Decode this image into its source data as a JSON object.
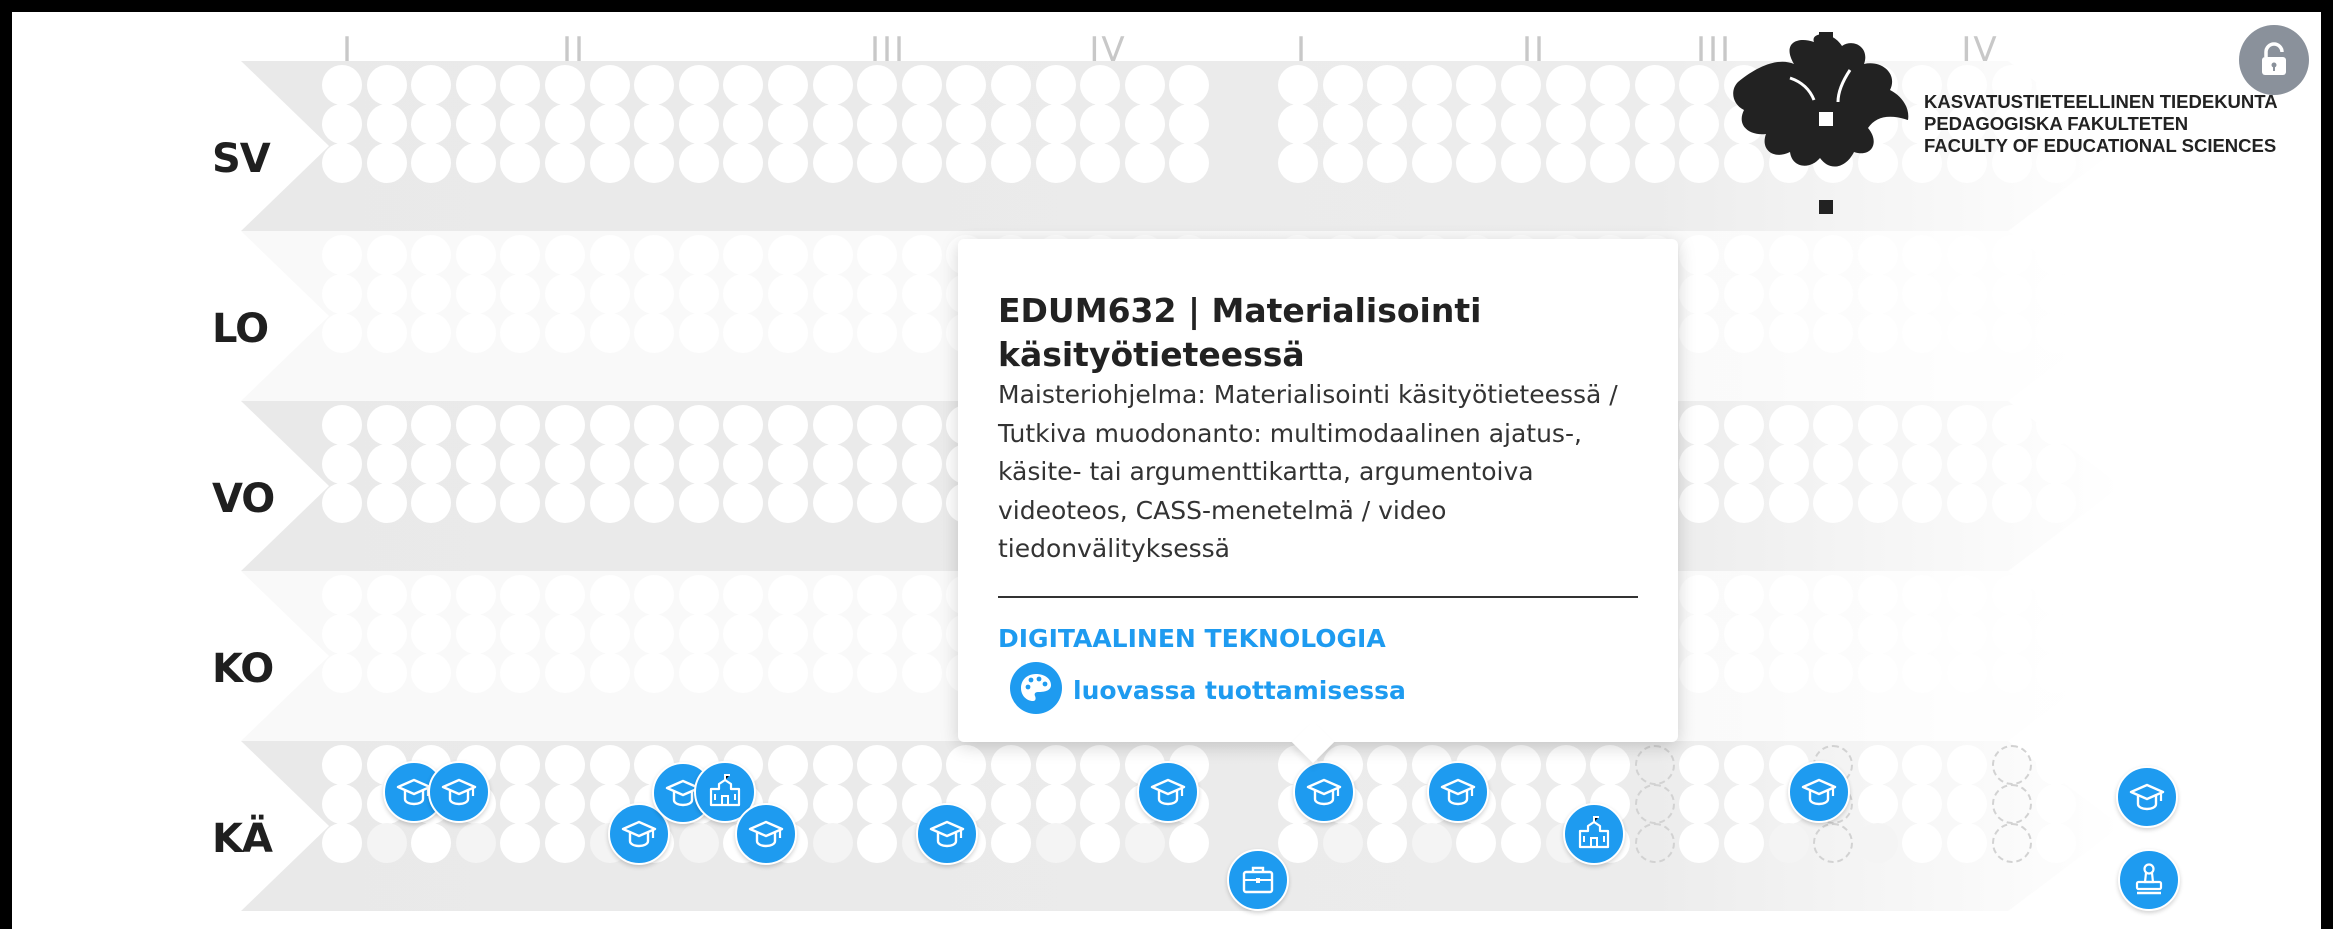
{
  "periods": [
    "I",
    "II",
    "III",
    "IV",
    "I",
    "II",
    "III",
    "IV"
  ],
  "rows": [
    {
      "code": "SV",
      "state": "active"
    },
    {
      "code": "LO",
      "state": "faded"
    },
    {
      "code": "VO",
      "state": "active"
    },
    {
      "code": "KO",
      "state": "faded"
    },
    {
      "code": "KÄ",
      "state": "selected"
    }
  ],
  "logo": {
    "lines": [
      "KASVATUSTIETEELLINEN TIEDEKUNTA",
      "PEDAGOGISKA FAKULTETEN",
      "FACULTY OF EDUCATIONAL SCIENCES"
    ]
  },
  "unlock_button": {
    "icon": "unlock-icon"
  },
  "tooltip": {
    "title": "EDUM632 | Materialisointi käsityötieteessä",
    "body": "Maisteriohjelma: Materialisointi käsityötieteessä / Tutkiva muodonanto: multimodaalinen ajatus-, käsite- tai argumenttikartta, argumentoiva videoteos,  CASS-menetelmä / video tiedonvälityksessä",
    "category": "DIGITAALINEN TEKNOLOGIA",
    "subcategory": "luovassa tuottamisessa",
    "subcategory_icon": "palette-icon"
  },
  "colors": {
    "accent": "#1e9bf0",
    "band": "#e9e9e9",
    "label": "#1f1f1f"
  },
  "course_badges": [
    {
      "icon": "graduation-cap-icon"
    },
    {
      "icon": "graduation-cap-icon"
    },
    {
      "icon": "graduation-cap-icon"
    },
    {
      "icon": "graduation-cap-icon"
    },
    {
      "icon": "school-building-icon"
    },
    {
      "icon": "graduation-cap-icon"
    },
    {
      "icon": "graduation-cap-icon"
    },
    {
      "icon": "graduation-cap-icon"
    },
    {
      "icon": "graduation-cap-icon"
    },
    {
      "icon": "briefcase-icon"
    },
    {
      "icon": "graduation-cap-icon"
    },
    {
      "icon": "school-building-icon"
    },
    {
      "icon": "graduation-cap-icon"
    },
    {
      "icon": "graduation-cap-icon"
    },
    {
      "icon": "stamp-icon"
    }
  ]
}
